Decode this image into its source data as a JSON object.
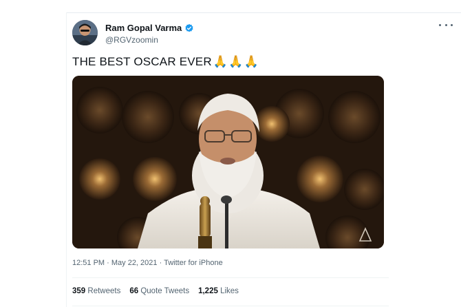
{
  "tweet": {
    "display_name": "Ram Gopal Varma",
    "handle": "@RGVzoomin",
    "verified": true,
    "text": "THE BEST OSCAR EVER",
    "emojis": [
      "🙏",
      "🙏",
      "🙏"
    ],
    "timestamp": "12:51 PM · May 22, 2021 · Twitter for iPhone",
    "stats": {
      "retweets_count": "359",
      "retweets_label": "Retweets",
      "quote_count": "66",
      "quote_label": "Quote Tweets",
      "likes_count": "1,225",
      "likes_label": "Likes"
    }
  },
  "icons": {
    "verified": "verified-badge-icon",
    "more": "more-options-icon",
    "video_watermark": "award-logo-icon"
  },
  "colors": {
    "verified_blue": "#1d9bf0",
    "secondary_text": "#536471",
    "primary_text": "#0f1419"
  }
}
